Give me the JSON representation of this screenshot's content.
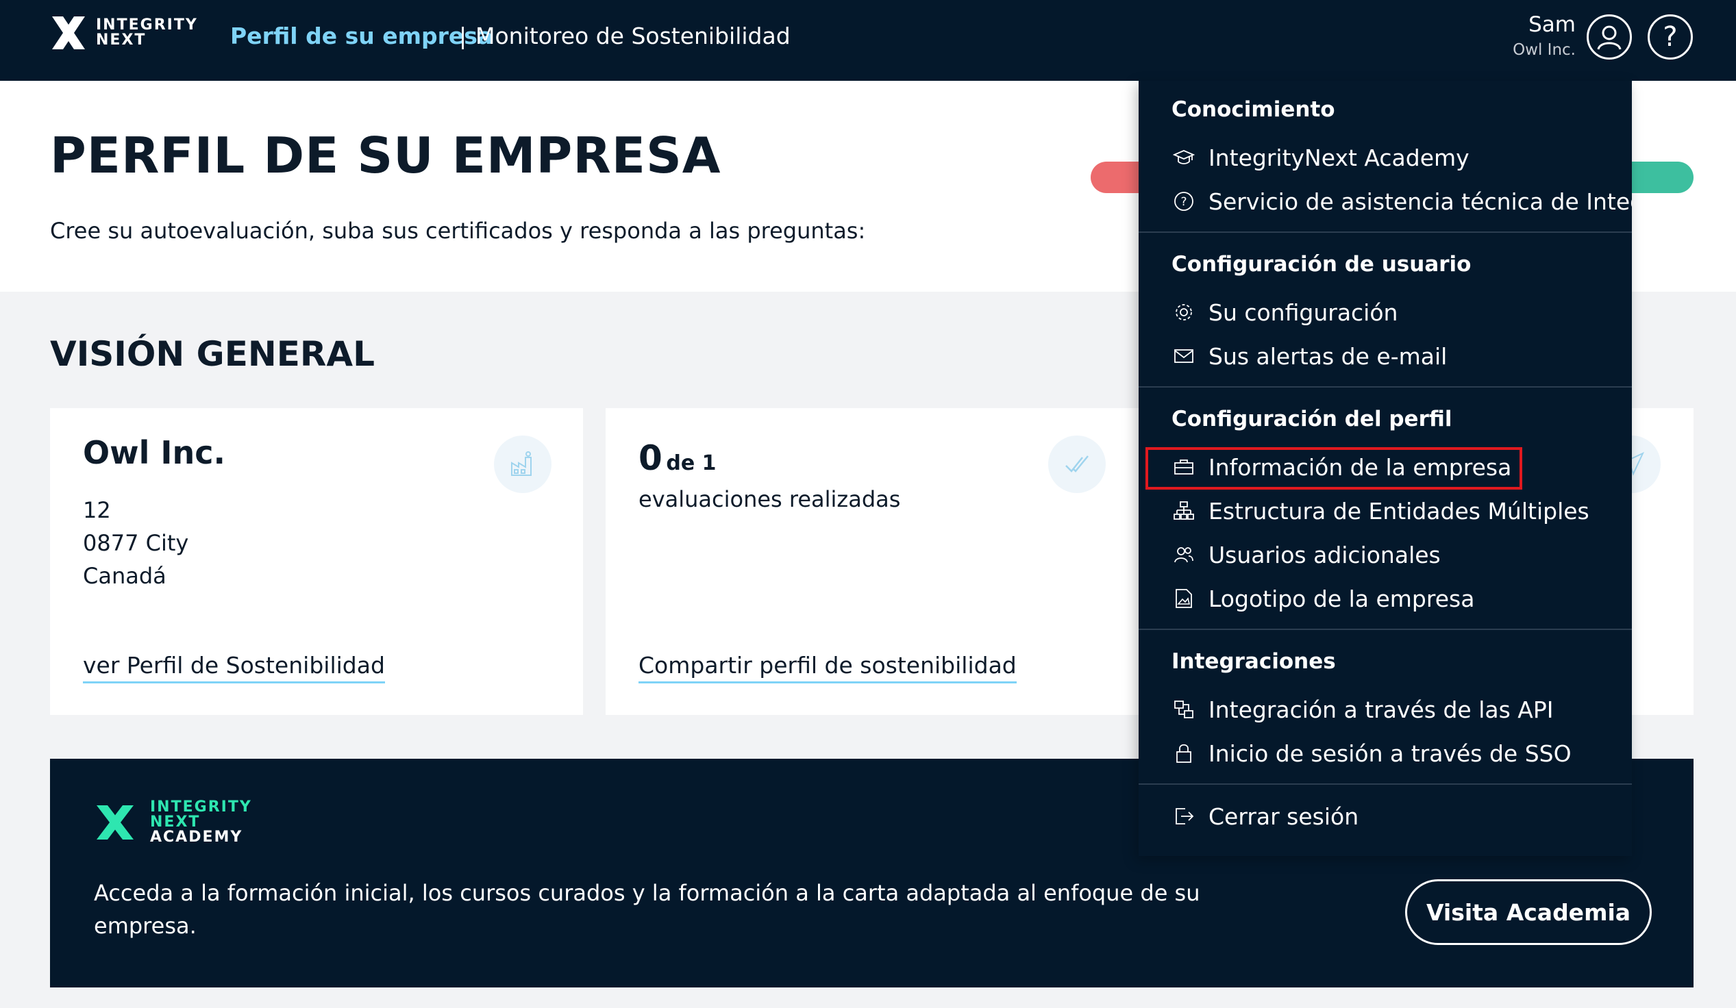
{
  "topbar": {
    "logo_text_line1": "INTEGRITY",
    "logo_text_line2": "NEXT",
    "nav_active": "Perfil de su empresa",
    "nav_separator": "|",
    "nav_inactive": "Monitoreo de Sostenibilidad",
    "user_name": "Sam",
    "user_company": "Owl Inc.",
    "help_label": "?"
  },
  "header": {
    "title": "PERFIL DE SU EMPRESA",
    "subtitle": "Cree su autoevaluación, suba sus certificados y responda a las preguntas:"
  },
  "overview": {
    "title": "VISIÓN GENERAL",
    "company_card": {
      "name": "Owl Inc.",
      "address_line1": "12",
      "address_line2": "0877 City",
      "address_line3": "Canadá",
      "link": "ver Perfil de Sostenibilidad"
    },
    "eval_card": {
      "count": "0",
      "of_total": "de 1",
      "label": "evaluaciones realizadas",
      "link": "Compartir perfil de sostenibilidad"
    }
  },
  "academy": {
    "logo_line1": "INTEGRITY",
    "logo_line2": "NEXT",
    "logo_line3": "ACADEMY",
    "text": "Acceda a la formación inicial, los cursos curados y la formación a la carta adaptada al enfoque de su empresa.",
    "button": "Visita Academia"
  },
  "dropdown": {
    "sections": [
      {
        "heading": "Conocimiento",
        "items": [
          {
            "label": "IntegrityNext Academy",
            "icon": "graduation-cap-icon"
          },
          {
            "label": "Servicio de asistencia técnica de IntegrityNext",
            "icon": "help-circle-icon"
          }
        ]
      },
      {
        "heading": "Configuración de usuario",
        "items": [
          {
            "label": "Su configuración",
            "icon": "gear-icon"
          },
          {
            "label": "Sus alertas de e-mail",
            "icon": "envelope-icon"
          }
        ]
      },
      {
        "heading": "Configuración del perfil",
        "items": [
          {
            "label": "Información de la empresa",
            "icon": "briefcase-icon"
          },
          {
            "label": "Estructura de Entidades Múltiples",
            "icon": "org-chart-icon"
          },
          {
            "label": "Usuarios adicionales",
            "icon": "users-icon"
          },
          {
            "label": "Logotipo de la empresa",
            "icon": "image-file-icon"
          }
        ]
      },
      {
        "heading": "Integraciones",
        "items": [
          {
            "label": "Integración a través de las API",
            "icon": "api-icon"
          },
          {
            "label": "Inicio de sesión a través de SSO",
            "icon": "lock-icon"
          }
        ]
      }
    ],
    "logout": {
      "label": "Cerrar sesión",
      "icon": "logout-icon"
    }
  },
  "colors": {
    "navy": "#04182b",
    "accent_blue": "#7fd3f7",
    "highlight_red": "#e0191f",
    "bar_red": "#ec6b6d",
    "bar_green": "#3dbf9f",
    "academy_green": "#2ee6b0"
  }
}
